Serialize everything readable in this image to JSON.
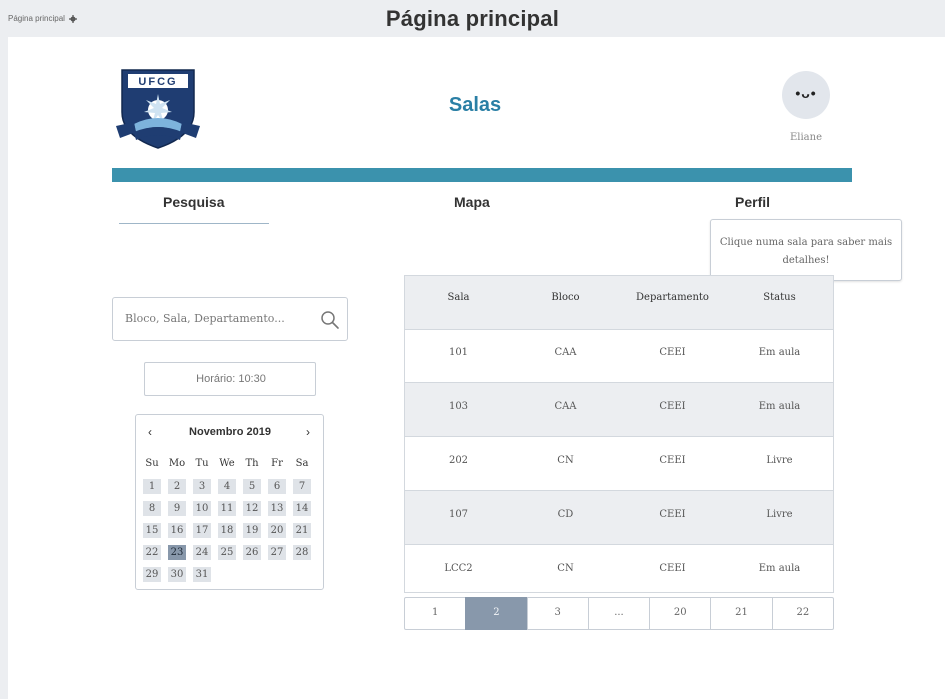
{
  "window": {
    "breadcrumb": "Página principal",
    "title": "Página principal"
  },
  "header": {
    "logo_text": "UFCG",
    "app_title": "Salas",
    "user_name": "Eliane",
    "avatar_face": "•ᴗ•",
    "accent_color": "#3b92ad"
  },
  "nav": {
    "items": [
      {
        "label": "Pesquisa"
      },
      {
        "label": "Mapa"
      },
      {
        "label": "Perfil"
      }
    ],
    "active": "Pesquisa"
  },
  "tooltip": {
    "text": "Clique numa sala para saber mais detalhes!"
  },
  "search": {
    "placeholder": "Bloco, Sala, Departamento...",
    "icon": "search-icon"
  },
  "time": {
    "label": "Horário: 10:30"
  },
  "calendar": {
    "month": "Novembro 2019",
    "prev": "‹",
    "next": "›",
    "weekdays": [
      "Su",
      "Mo",
      "Tu",
      "We",
      "Th",
      "Fr",
      "Sa"
    ],
    "weeks": [
      [
        "1",
        "2",
        "3",
        "4",
        "5",
        "6",
        "7"
      ],
      [
        "8",
        "9",
        "10",
        "11",
        "12",
        "13",
        "14"
      ],
      [
        "15",
        "16",
        "17",
        "18",
        "19",
        "20",
        "21"
      ],
      [
        "22",
        "23",
        "24",
        "25",
        "26",
        "27",
        "28"
      ],
      [
        "29",
        "30",
        "31"
      ]
    ],
    "selected": "23"
  },
  "table": {
    "columns": [
      "Sala",
      "Bloco",
      "Departamento",
      "Status"
    ],
    "rows": [
      [
        "101",
        "CAA",
        "CEEI",
        "Em aula"
      ],
      [
        "103",
        "CAA",
        "CEEI",
        "Em aula"
      ],
      [
        "202",
        "CN",
        "CEEI",
        "Livre"
      ],
      [
        "107",
        "CD",
        "CEEI",
        "Livre"
      ],
      [
        "LCC2",
        "CN",
        "CEEI",
        "Em aula"
      ]
    ]
  },
  "pagination": {
    "pages": [
      "1",
      "2",
      "3",
      "...",
      "20",
      "21",
      "22"
    ],
    "current": "2"
  }
}
